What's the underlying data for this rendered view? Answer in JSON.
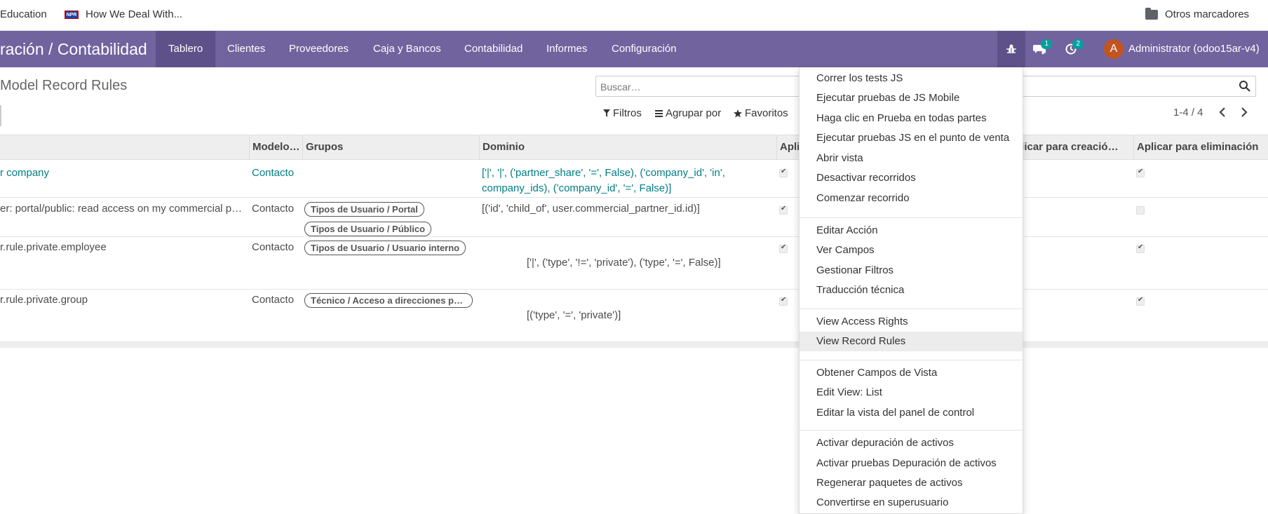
{
  "bookmarks": {
    "items": [
      {
        "label": "Education"
      },
      {
        "label": "How We Deal With...",
        "favicon_text": "NPR"
      }
    ],
    "other": "Otros marcadores"
  },
  "navbar": {
    "app_title": "ración / Contabilidad",
    "menu": [
      "Tablero",
      "Clientes",
      "Proveedores",
      "Caja y Bancos",
      "Contabilidad",
      "Informes",
      "Configuración"
    ],
    "active_menu": "Tablero",
    "messages_badge": "1",
    "activities_badge": "2",
    "avatar_initial": "A",
    "user": "Administrator (odoo15ar-v4)"
  },
  "control_panel": {
    "breadcrumb": "Model Record Rules",
    "search_placeholder": "Buscar…",
    "filters": "Filtros",
    "group_by": "Agrupar por",
    "favorites": "Favoritos",
    "pager": "1-4 / 4"
  },
  "table": {
    "headers": {
      "model": "Modelo…",
      "groups": "Grupos",
      "domain": "Dominio",
      "apply_read": "Apli",
      "apply_create": "plicar para creació…",
      "apply_delete": "Aplicar para eliminación"
    },
    "rows": [
      {
        "name": "r company",
        "model": "Contacto",
        "groups": [],
        "domain_line1": "['|', '|', ('partner_share', '=', False), ('company_id', 'in',",
        "domain_line2": "company_ids), ('company_id', '=', False)]",
        "apply_read": true,
        "apply_delete": true
      },
      {
        "name": "er: portal/public: read access on my commercial partner",
        "model": "Contacto",
        "groups": [
          "Tipos de Usuario / Portal",
          "Tipos de Usuario / Público"
        ],
        "domain_line1": "[('id', 'child_of', user.commercial_partner_id.id)]",
        "apply_read": true,
        "apply_delete": false
      },
      {
        "name": "r.rule.private.employee",
        "model": "Contacto",
        "groups": [
          "Tipos de Usuario / Usuario interno"
        ],
        "domain_line1": "['|', ('type', '!=', 'private'), ('type', '=', False)]",
        "apply_read": true,
        "apply_delete": true
      },
      {
        "name": "r.rule.private.group",
        "model": "Contacto",
        "groups": [
          "Técnico / Acceso a direcciones privadas"
        ],
        "domain_line1": "[('type', '=', 'private')]",
        "apply_read": true,
        "apply_delete": true
      }
    ]
  },
  "debug_menu": {
    "group1": [
      "Correr los tests JS",
      "Ejecutar pruebas de JS Mobile",
      "Haga clic en Prueba en todas partes",
      "Ejecutar pruebas JS en el punto de venta",
      "Abrir vista",
      "Desactivar recorridos",
      "Comenzar recorrido"
    ],
    "group2": [
      "Editar Acción",
      "Ver Campos",
      "Gestionar Filtros",
      "Traducción técnica"
    ],
    "group3": [
      "View Access Rights",
      "View Record Rules"
    ],
    "group4": [
      "Obtener Campos de Vista",
      "Edit View: List",
      "Editar la vista del panel de control"
    ],
    "group5": [
      "Activar depuración de activos",
      "Activar pruebas Depuración de activos",
      "Regenerar paquetes de activos",
      "Convertirse en superusuario"
    ],
    "highlighted": "View Record Rules"
  }
}
